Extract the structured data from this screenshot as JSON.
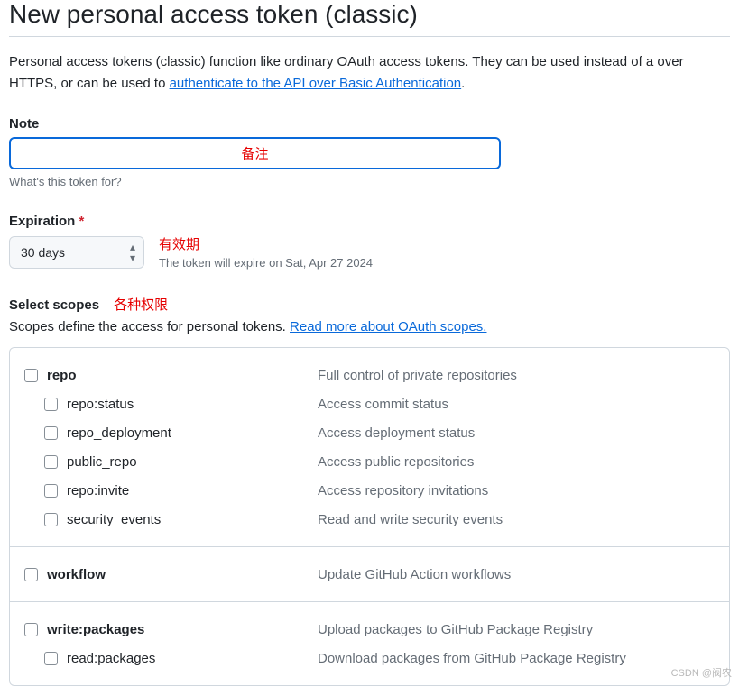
{
  "page": {
    "title": "New personal access token (classic)"
  },
  "intro": {
    "part1": "Personal access tokens (classic) function like ordinary OAuth access tokens. They can be used instead of a over HTTPS, or can be used to ",
    "link": "authenticate to the API over Basic Authentication",
    "part2": "."
  },
  "note": {
    "label": "Note",
    "value": "",
    "overlay": "备注",
    "help": "What's this token for?"
  },
  "expiration": {
    "label": "Expiration",
    "selected": "30 days",
    "annot": "有效期",
    "desc": "The token will expire on Sat, Apr 27 2024"
  },
  "scopes": {
    "title": "Select scopes",
    "annot": "各种权限",
    "intro_text": "Scopes define the access for personal tokens. ",
    "intro_link": "Read more about OAuth scopes.",
    "groups": [
      {
        "parent": {
          "name": "repo",
          "desc": "Full control of private repositories"
        },
        "children": [
          {
            "name": "repo:status",
            "desc": "Access commit status"
          },
          {
            "name": "repo_deployment",
            "desc": "Access deployment status"
          },
          {
            "name": "public_repo",
            "desc": "Access public repositories"
          },
          {
            "name": "repo:invite",
            "desc": "Access repository invitations"
          },
          {
            "name": "security_events",
            "desc": "Read and write security events"
          }
        ]
      },
      {
        "parent": {
          "name": "workflow",
          "desc": "Update GitHub Action workflows"
        },
        "children": []
      },
      {
        "parent": {
          "name": "write:packages",
          "desc": "Upload packages to GitHub Package Registry"
        },
        "children": [
          {
            "name": "read:packages",
            "desc": "Download packages from GitHub Package Registry"
          }
        ]
      }
    ]
  },
  "watermark": "CSDN @阀农"
}
